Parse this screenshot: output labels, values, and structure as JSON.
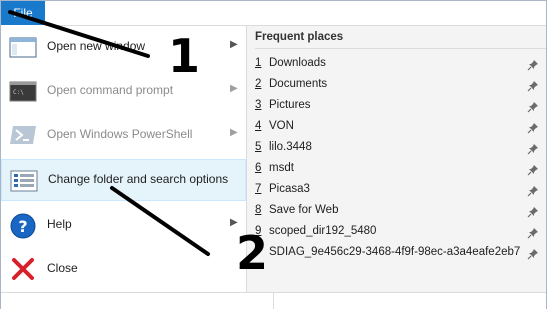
{
  "file_tab": "File",
  "menu": [
    {
      "label": "Open new window",
      "enabled": true,
      "submenu": true
    },
    {
      "label": "Open command prompt",
      "enabled": false,
      "submenu": true
    },
    {
      "label": "Open Windows PowerShell",
      "enabled": false,
      "submenu": true
    },
    {
      "label": "Change folder and search options",
      "enabled": true,
      "submenu": false
    },
    {
      "label": "Help",
      "enabled": true,
      "submenu": true
    },
    {
      "label": "Close",
      "enabled": true,
      "submenu": false
    }
  ],
  "frequent_places": {
    "title": "Frequent places",
    "items": [
      {
        "num": "1",
        "name": "Downloads"
      },
      {
        "num": "2",
        "name": "Documents"
      },
      {
        "num": "3",
        "name": "Pictures"
      },
      {
        "num": "4",
        "name": "VON"
      },
      {
        "num": "5",
        "name": "lilo.3448"
      },
      {
        "num": "6",
        "name": "msdt"
      },
      {
        "num": "7",
        "name": "Picasa3"
      },
      {
        "num": "8",
        "name": "Save for Web"
      },
      {
        "num": "9",
        "name": "scoped_dir192_5480"
      },
      {
        "num": "",
        "name": "SDIAG_9e456c29-3468-4f9f-98ec-a3a4eafe2eb7"
      }
    ]
  },
  "annotations": [
    "1",
    "2"
  ],
  "colors": {
    "file_tab": "#1979ca",
    "highlight": "#e5f3fb",
    "pane": "#f4f4f4"
  }
}
